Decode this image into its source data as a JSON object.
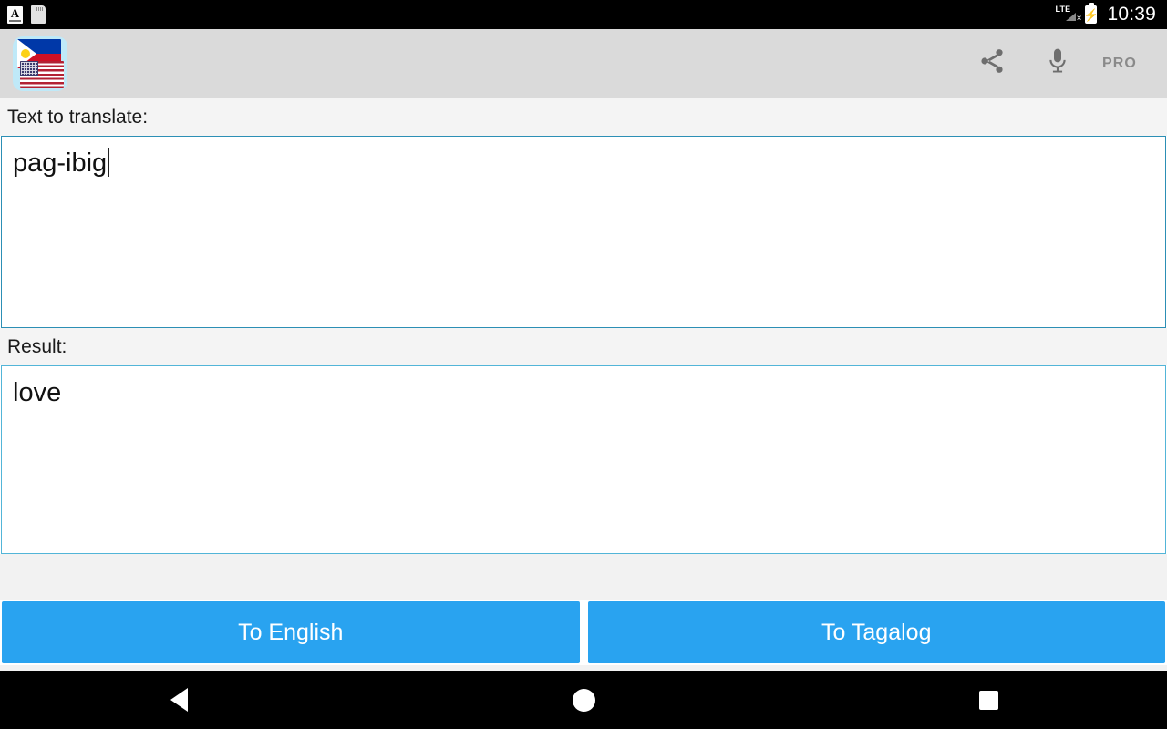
{
  "status_bar": {
    "ime_icon": "keyboard-input-method-icon",
    "ime_letter": "A",
    "sd_icon": "sd-card-icon",
    "network_label": "LTE",
    "network_state_icon": "no-signal-x-icon",
    "battery_icon": "battery-charging-icon",
    "battery_glyph": "⚡",
    "time": "10:39"
  },
  "action_bar": {
    "app_icon": "philippines-usa-flags-app-icon",
    "share_icon": "share-icon",
    "mic_icon": "microphone-icon",
    "pro_label": "PRO",
    "background_color": "#dadada"
  },
  "main": {
    "input_label": "Text to translate:",
    "input_value": "pag-ibig",
    "input_placeholder": "",
    "result_label": "Result:",
    "result_value": "love",
    "field_border_color": "#2c8fb5",
    "label_background": "#f4f4f4"
  },
  "buttons": {
    "to_english": "To English",
    "to_tagalog": "To Tagalog",
    "accent_color": "#29a3f0"
  },
  "nav_bar": {
    "back_icon": "back-triangle-icon",
    "home_icon": "home-circle-icon",
    "recents_icon": "recents-square-icon"
  }
}
